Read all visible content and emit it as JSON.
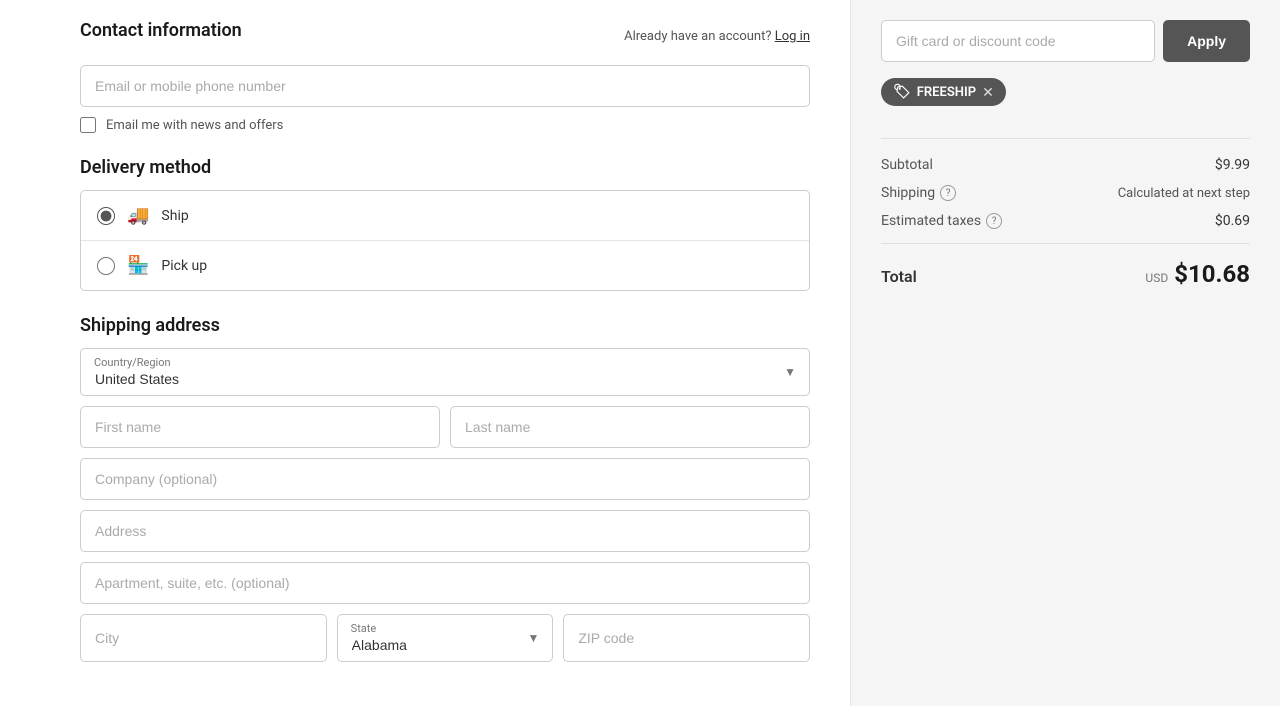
{
  "contact": {
    "title": "Contact information",
    "already_account": "Already have an account?",
    "log_in": "Log in",
    "email_placeholder": "Email or mobile phone number",
    "checkbox_label": "Email me with news and offers"
  },
  "delivery": {
    "title": "Delivery method",
    "options": [
      {
        "id": "ship",
        "label": "Ship",
        "selected": true
      },
      {
        "id": "pickup",
        "label": "Pick up",
        "selected": false
      }
    ]
  },
  "shipping": {
    "title": "Shipping address",
    "country_label": "Country/Region",
    "country_value": "United States",
    "first_name_placeholder": "First name",
    "last_name_placeholder": "Last name",
    "company_placeholder": "Company (optional)",
    "address_placeholder": "Address",
    "apt_placeholder": "Apartment, suite, etc. (optional)",
    "city_placeholder": "City",
    "state_label": "State",
    "state_value": "Alabama",
    "zip_placeholder": "ZIP code"
  },
  "discount": {
    "placeholder": "Gift card or discount code",
    "apply_label": "Apply",
    "coupon_code": "FREESHIP"
  },
  "order_summary": {
    "subtotal_label": "Subtotal",
    "subtotal_value": "$9.99",
    "shipping_label": "Shipping",
    "shipping_value": "Calculated at next step",
    "taxes_label": "Estimated taxes",
    "taxes_value": "$0.69",
    "total_label": "Total",
    "total_currency": "USD",
    "total_amount": "$10.68"
  }
}
